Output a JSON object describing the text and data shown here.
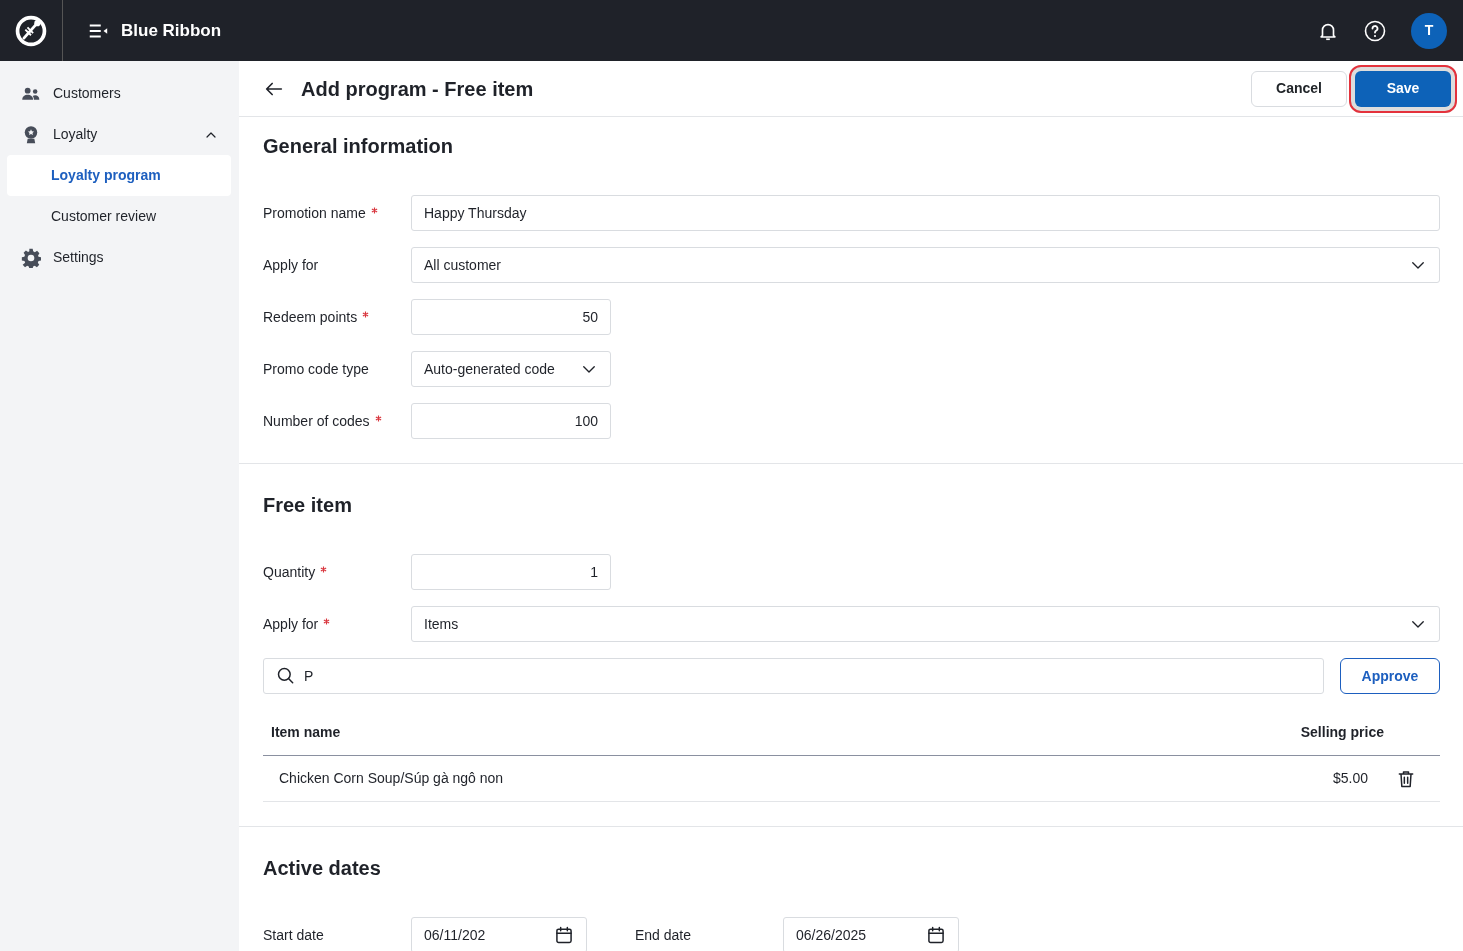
{
  "app": {
    "title": "Blue Ribbon",
    "avatar": "T"
  },
  "sidebar": {
    "items": [
      {
        "label": "Customers",
        "selected": false
      },
      {
        "label": "Loyalty",
        "selected": false,
        "expanded": true,
        "children": [
          {
            "label": "Loyalty program",
            "selected": true
          },
          {
            "label": "Customer review",
            "selected": false
          }
        ]
      },
      {
        "label": "Settings",
        "selected": false
      }
    ]
  },
  "header": {
    "title": "Add program - Free item",
    "cancel": "Cancel",
    "save": "Save",
    "save_highlighted": true
  },
  "general": {
    "title": "General information",
    "fields": [
      {
        "label": "Promotion name",
        "required": true,
        "kind": "text",
        "value": "Happy Thursday"
      },
      {
        "label": "Apply for",
        "required": false,
        "kind": "select",
        "value": "All customer"
      },
      {
        "label": "Redeem points",
        "required": true,
        "kind": "number",
        "value": "50"
      },
      {
        "label": "Promo code type",
        "required": false,
        "kind": "select-short",
        "value": "Auto-generated code"
      },
      {
        "label": "Number of codes",
        "required": true,
        "kind": "number",
        "value": "100"
      }
    ]
  },
  "free_item": {
    "title": "Free item",
    "fields": [
      {
        "label": "Quantity",
        "required": true,
        "kind": "number",
        "value": "1"
      },
      {
        "label": "Apply for",
        "required": true,
        "kind": "select",
        "value": "Items"
      }
    ],
    "search": {
      "value": "P"
    },
    "approve": "Approve",
    "table": {
      "columns": [
        "Item name",
        "Selling price"
      ],
      "rows": [
        {
          "name": "Chicken Corn Soup/Súp gà ngô non",
          "price": "$5.00"
        }
      ]
    }
  },
  "active_dates": {
    "title": "Active dates",
    "fields": [
      {
        "label": "Start date",
        "value": "06/11/202"
      },
      {
        "label": "End date",
        "value": "06/26/2025"
      }
    ]
  }
}
